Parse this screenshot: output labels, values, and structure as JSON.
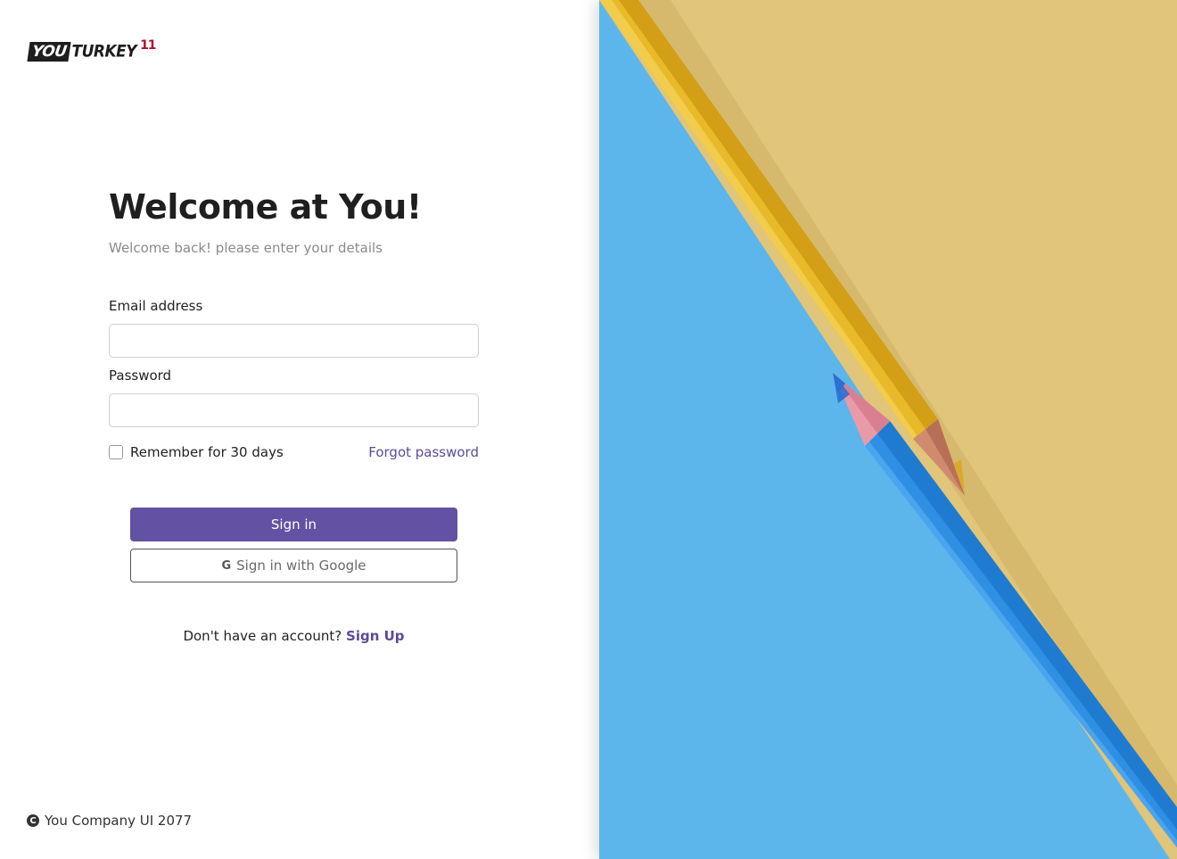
{
  "logo": {
    "part1": "YOU",
    "part2": "TURKEY",
    "mark": "11"
  },
  "heading": {
    "title": "Welcome at You!",
    "subtitle": "Welcome back! please enter your details"
  },
  "form": {
    "email_label": "Email address",
    "email_value": "",
    "password_label": "Password",
    "password_value": "",
    "remember_label": "Remember for 30 days",
    "remember_checked": false,
    "forgot_label": "Forgot password",
    "signin_label": "Sign in",
    "google_icon": "G",
    "google_label": "Sign in with Google"
  },
  "signup": {
    "prompt": "Don't have an account?",
    "link": "Sign Up"
  },
  "footer": {
    "icon": "copyright-icon",
    "text": "You Company UI 2077"
  },
  "hero_image": {
    "description_icon": "pencils-image"
  },
  "colors": {
    "accent": "#6351a3",
    "link": "#5d4a9b",
    "hero_yellow": "#e0c57a",
    "hero_blue": "#5cb6ec",
    "logo_red": "#b0102a"
  }
}
